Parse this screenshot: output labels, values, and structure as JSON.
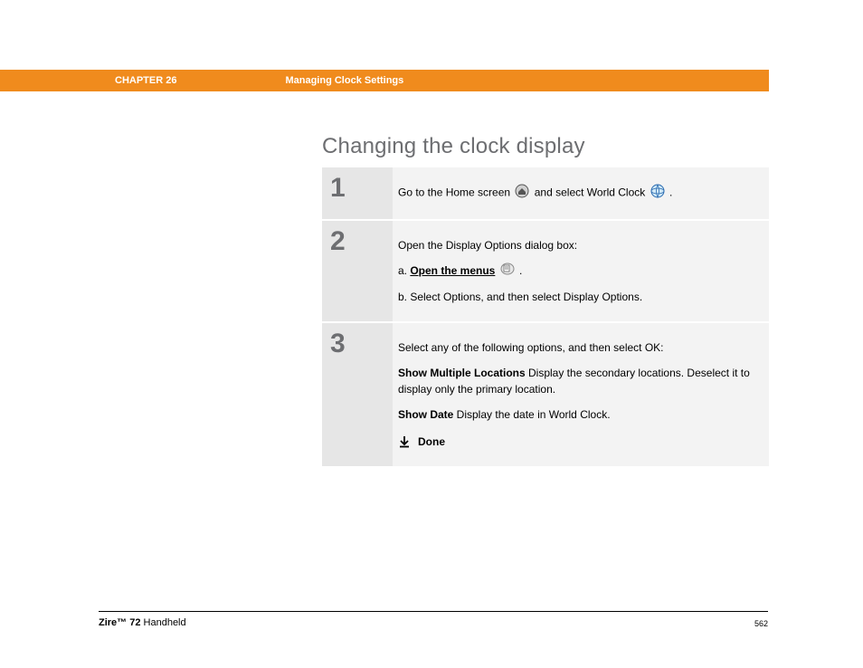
{
  "header": {
    "chapter": "CHAPTER 26",
    "title": "Managing Clock Settings"
  },
  "page_title": "Changing the clock display",
  "steps": [
    {
      "num": "1",
      "text_before_icon1": "Go to the Home screen ",
      "text_mid": " and select World Clock ",
      "text_after": "."
    },
    {
      "num": "2",
      "intro": "Open the Display Options dialog box:",
      "sub_a_prefix": "a.  ",
      "sub_a_link": "Open the menus",
      "sub_a_after": " .",
      "sub_b": "b.  Select Options, and then select Display Options."
    },
    {
      "num": "3",
      "intro": "Select any of the following options, and then select OK:",
      "opt1_label": "Show Multiple Locations",
      "opt1_text": "   Display the secondary locations. Deselect it to display only the primary location.",
      "opt2_label": "Show Date",
      "opt2_text": "   Display the date in World Clock.",
      "done": "Done"
    }
  ],
  "footer": {
    "brand": "Zire™ 72",
    "product": " Handheld",
    "page": "562"
  }
}
